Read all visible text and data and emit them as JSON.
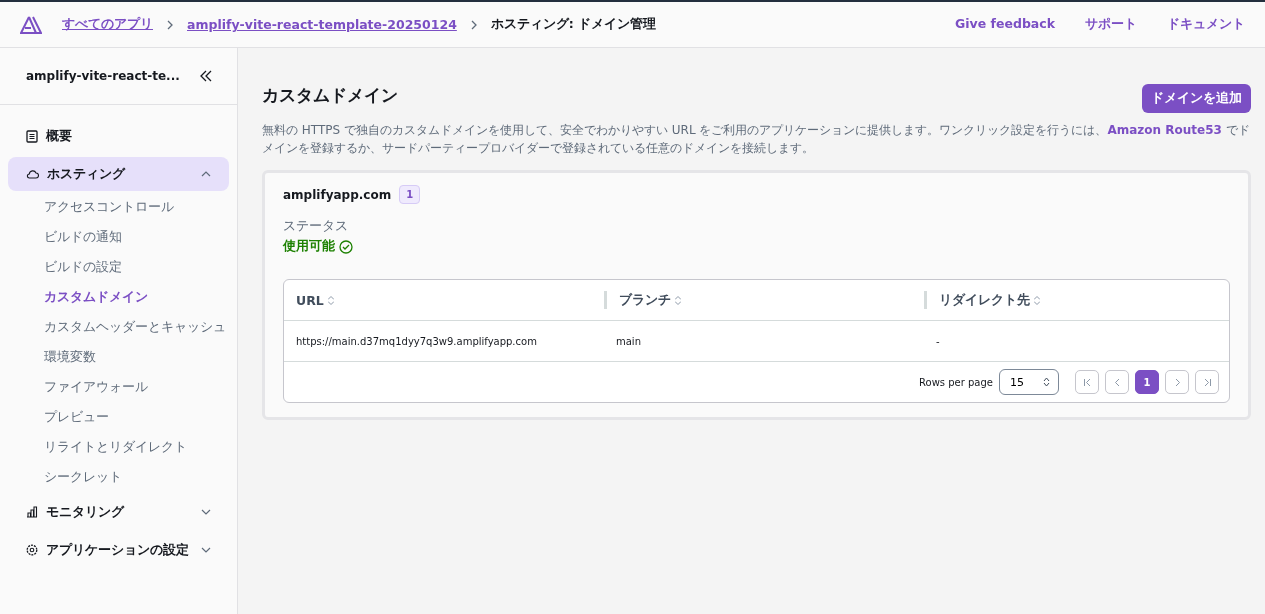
{
  "breadcrumbs": [
    {
      "label": "すべてのアプリ",
      "link": true
    },
    {
      "label": "amplify-vite-react-template-20250124",
      "link": true
    },
    {
      "label": "ホスティング: ドメイン管理",
      "link": false
    }
  ],
  "header_links": [
    "Give feedback",
    "サポート",
    "ドキュメント"
  ],
  "sidebar": {
    "app_name": "amplify-vite-react-te...",
    "items": [
      {
        "label": "概要",
        "kind": "link",
        "selected": false
      },
      {
        "label": "ホスティング",
        "kind": "group",
        "selected": true,
        "expanded": true,
        "children": [
          {
            "label": "アクセスコントロール",
            "selected": false
          },
          {
            "label": "ビルドの通知",
            "selected": false
          },
          {
            "label": "ビルドの設定",
            "selected": false
          },
          {
            "label": "カスタムドメイン",
            "selected": true
          },
          {
            "label": "カスタムヘッダーとキャッシュ",
            "selected": false
          },
          {
            "label": "環境変数",
            "selected": false
          },
          {
            "label": "ファイアウォール",
            "selected": false
          },
          {
            "label": "プレビュー",
            "selected": false
          },
          {
            "label": "リライトとリダイレクト",
            "selected": false
          },
          {
            "label": "シークレット",
            "selected": false
          }
        ]
      },
      {
        "label": "モニタリング",
        "kind": "group",
        "selected": false,
        "expanded": false
      },
      {
        "label": "アプリケーションの設定",
        "kind": "group",
        "selected": false,
        "expanded": false
      }
    ]
  },
  "page": {
    "title": "カスタムドメイン",
    "add_button": "ドメインを追加",
    "description": {
      "before": "無料の HTTPS で独自のカスタムドメインを使用して、安全でわかりやすい URL をご利用のアプリケーションに提供します。ワンクリック設定を行うには、",
      "link": "Amazon Route53",
      "after": " でドメインを登録するか、サードパーティープロバイダーで登録されている任意のドメインを接続します。"
    }
  },
  "domain": {
    "name": "amplifyapp.com",
    "count": "1",
    "status_label": "ステータス",
    "status": "使用可能",
    "table": {
      "columns": [
        "URL",
        "ブランチ",
        "リダイレクト先"
      ],
      "rows": [
        [
          "https://main.d37mq1dyy7q3w9.amplifyapp.com",
          "main",
          "-"
        ]
      ]
    },
    "rows_per_page_label": "Rows per page",
    "rows_per_page": "15",
    "pages": [
      {
        "label": "1",
        "selected": true
      }
    ]
  }
}
